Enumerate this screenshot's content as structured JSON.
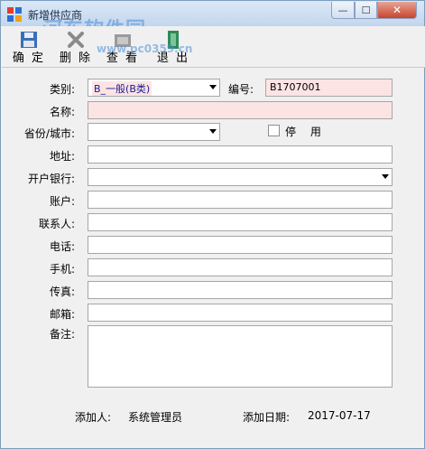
{
  "window": {
    "title": "新增供应商",
    "watermark": "河东软件园",
    "watermark_url": "www.pc0359.cn",
    "controls": {
      "minimize": "—",
      "maximize": "☐",
      "close": "✕"
    }
  },
  "toolbar": {
    "confirm_label": "确 定",
    "delete_label": "删 除",
    "view_label": "查 看",
    "exit_label": "退 出"
  },
  "form": {
    "category_label": "类别:",
    "category_value": "B_一般(B类)",
    "code_label": "编号:",
    "code_value": "B1707001",
    "name_label": "名称:",
    "name_value": "",
    "province_label": "省份/城市:",
    "province_value": "",
    "disable_label": "停 用",
    "address_label": "地址:",
    "bank_label": "开户银行:",
    "account_label": "账户:",
    "contact_label": "联系人:",
    "phone_label": "电话:",
    "mobile_label": "手机:",
    "fax_label": "传真:",
    "email_label": "邮箱:",
    "remark_label": "备注:"
  },
  "footer": {
    "creator_label": "添加人:",
    "creator_value": "系统管理员",
    "date_label": "添加日期:",
    "date_value": "2017-07-17"
  },
  "colors": {
    "required_field_bg": "#fde4e4",
    "titlebar": "#c3d6ee",
    "close_button": "#c8442d"
  }
}
